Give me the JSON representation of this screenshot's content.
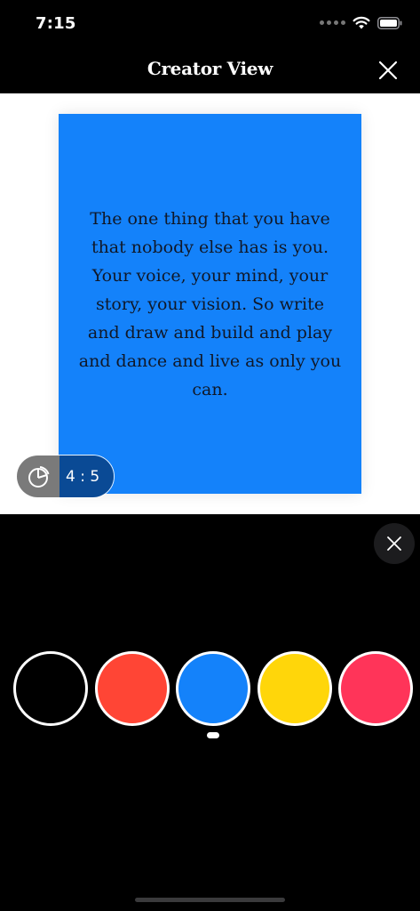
{
  "status_bar": {
    "time": "7:15"
  },
  "nav": {
    "title": "Creator View"
  },
  "post": {
    "text": "The one thing that you have that nobody else has is you. Your voice, your mind, your story, your vision. So write and draw and build and play and dance and live as only you can.",
    "background_color": "#1482FA"
  },
  "ratio": {
    "label": "4 : 5"
  },
  "colors": {
    "swatches": [
      {
        "name": "black",
        "hex": "#000000"
      },
      {
        "name": "red",
        "hex": "#FF4535"
      },
      {
        "name": "blue",
        "hex": "#1482FA"
      },
      {
        "name": "yellow",
        "hex": "#FFD60A"
      },
      {
        "name": "pink",
        "hex": "#FF3459"
      }
    ],
    "selected_index": 2
  },
  "icons": {
    "close": "close-icon",
    "aspect_ratio": "aspect-ratio-icon",
    "wifi": "wifi-icon",
    "battery": "battery-icon"
  }
}
